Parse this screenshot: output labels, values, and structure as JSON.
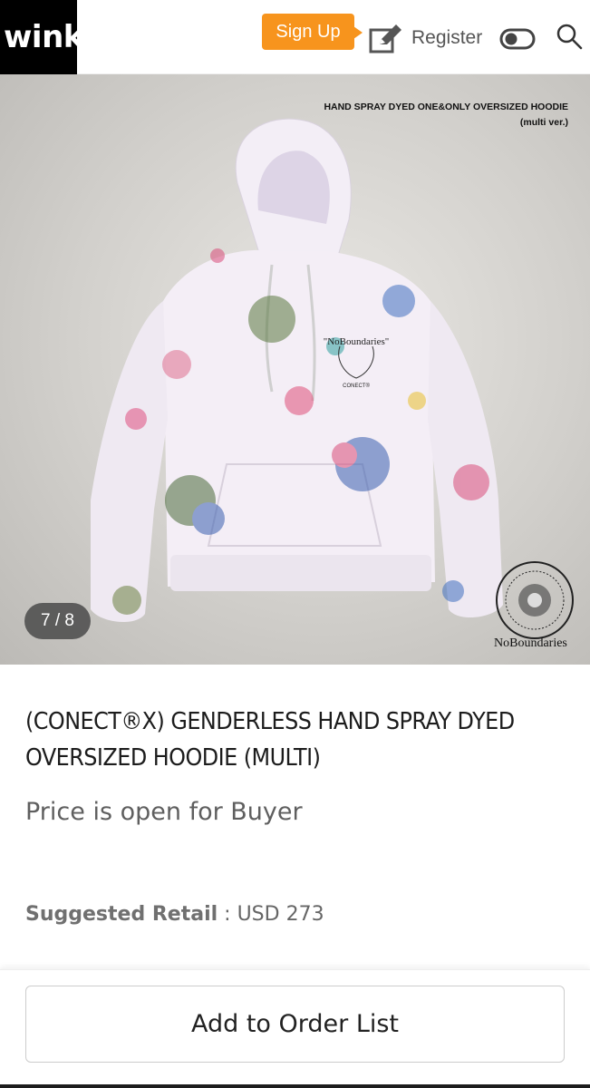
{
  "header": {
    "logo": "wink",
    "signup_label": "Sign Up",
    "register_label": "Register",
    "icons": [
      "register-edit-icon",
      "toggle-icon",
      "search-icon"
    ],
    "accent_color": "#f7941d"
  },
  "gallery": {
    "current": 7,
    "total": 8,
    "counter_text": "7 / 8",
    "promo_line1": "HAND SPRAY DYED ONE&ONLY OVERSIZED HOODIE",
    "promo_line2": "(multi ver.)",
    "chest_print": "\"NoBoundaries\"",
    "chest_sub": "CONECT®",
    "seal_label": "NoBoundaries"
  },
  "product": {
    "title": "(CONECT®X) GENDERLESS HAND SPRAY DYED OVERSIZED HOODIE (MULTI)",
    "price_note": "Price is open for Buyer",
    "retail_label": "Suggested Retail",
    "retail_value": "USD 273"
  },
  "footer": {
    "order_button": "Add to Order List"
  }
}
